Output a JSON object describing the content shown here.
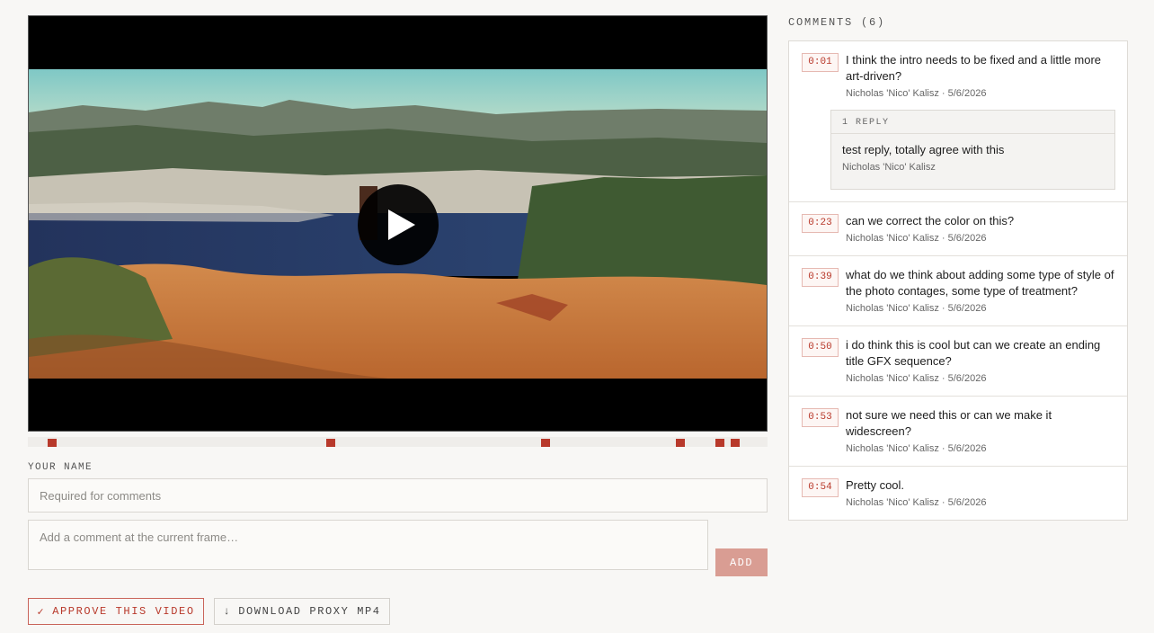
{
  "player": {
    "play_label": "Play"
  },
  "form": {
    "name_label": "YOUR NAME",
    "name_placeholder": "Required for comments",
    "comment_placeholder": "Add a comment at the current frame…",
    "add_label": "ADD"
  },
  "actions": {
    "approve_icon": "✓",
    "approve_label": "APPROVE THIS VIDEO",
    "download_icon": "↓",
    "download_label": "DOWNLOAD PROXY MP4"
  },
  "comments_header": "COMMENTS (6)",
  "comments": [
    {
      "time": "0:01",
      "text": "I think the intro needs to be fixed and a little more art-driven?",
      "meta": "Nicholas 'Nico' Kalisz · 5/6/2026",
      "replies_header": "1 REPLY",
      "replies": [
        {
          "text": "test reply, totally agree with this",
          "author": "Nicholas 'Nico' Kalisz"
        }
      ]
    },
    {
      "time": "0:23",
      "text": "can we correct the color on this?",
      "meta": "Nicholas 'Nico' Kalisz · 5/6/2026"
    },
    {
      "time": "0:39",
      "text": "what do we think about adding some type of style of the photo contages, some type of treatment?",
      "meta": "Nicholas 'Nico' Kalisz · 5/6/2026"
    },
    {
      "time": "0:50",
      "text": "i do think this is cool but can we create an ending title GFX sequence?",
      "meta": "Nicholas 'Nico' Kalisz · 5/6/2026"
    },
    {
      "time": "0:53",
      "text": "not sure we need this or can we make it widescreen?",
      "meta": "Nicholas 'Nico' Kalisz · 5/6/2026"
    },
    {
      "time": "0:54",
      "text": "Pretty cool.",
      "meta": "Nicholas 'Nico' Kalisz · 5/6/2026"
    }
  ],
  "colors": {
    "accent": "#b8392b",
    "accent_light": "#d99d93"
  }
}
